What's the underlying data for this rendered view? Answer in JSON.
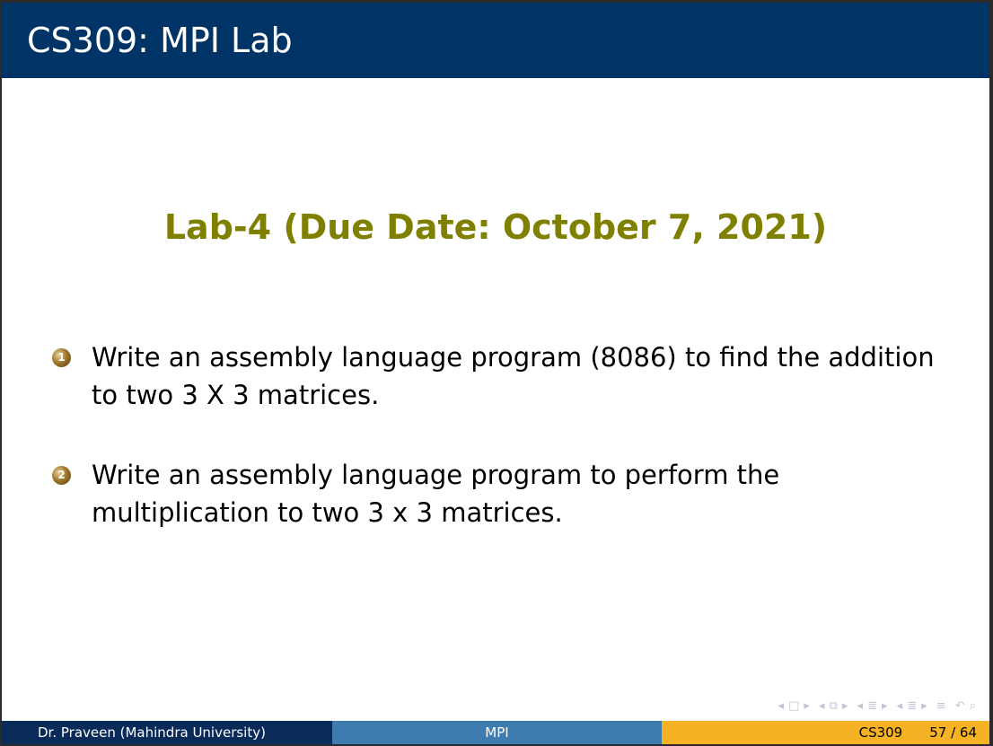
{
  "frame": {
    "title": "CS309: MPI Lab"
  },
  "heading": "Lab-4 (Due Date: October 7, 2021)",
  "items": [
    {
      "number": "1",
      "text": "Write an assembly language program (8086) to find the addition to two 3 X 3 matrices."
    },
    {
      "number": "2",
      "text": "Write an assembly language program to perform the multiplication to two 3 x 3 matrices."
    }
  ],
  "footer": {
    "author": "Dr. Praveen  (Mahindra University)",
    "short_title": "MPI",
    "course": "CS309",
    "page": "57 / 64"
  },
  "colors": {
    "title_bar": "#003366",
    "heading": "#808000",
    "footer_left": "#0a2a5a",
    "footer_mid": "#3e7cb0",
    "footer_right": "#f4b224"
  },
  "nav_icons": [
    "arrow-left-icon",
    "frame-icon",
    "arrow-right-icon",
    "arrow-left-icon",
    "subsection-icon",
    "arrow-right-icon",
    "arrow-left-icon",
    "section-icon",
    "arrow-right-icon",
    "arrow-left-icon",
    "align-icon",
    "arrow-right-icon",
    "align-icon",
    "undo-icon",
    "search-icon"
  ]
}
